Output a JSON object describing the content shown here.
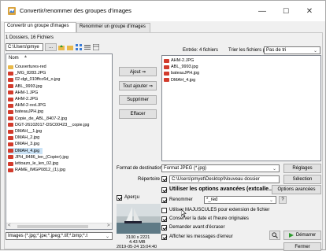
{
  "window": {
    "title": "Convertir/renommer des groupes d'images",
    "minimize": "—",
    "maximize": "☐",
    "close": "✕"
  },
  "tabs": [
    "Convertir un groupe d'images",
    "Renommer un groupe d'images"
  ],
  "left": {
    "summary": "1 Dossiers, 16 Fichiers",
    "path": "C:\\Users\\pmye",
    "path_btn": "...",
    "list_header": "Nom",
    "items": [
      {
        "name": "Couvertures-red",
        "type": "folder"
      },
      {
        "name": "_MG_8283.JPG",
        "type": "jpg"
      },
      {
        "name": "02-dgt_010ffcc6d_o.jpg",
        "type": "jpg"
      },
      {
        "name": "ABL_9993.jpg",
        "type": "jpg"
      },
      {
        "name": "AHM-1.JPG",
        "type": "jpg"
      },
      {
        "name": "AHM-2.JPG",
        "type": "jpg"
      },
      {
        "name": "AHM-2-red.JPG",
        "type": "jpg"
      },
      {
        "name": "bateauJPH.jpg",
        "type": "jpg"
      },
      {
        "name": "Copie_de_ABL_8407-2.jpg",
        "type": "jpg"
      },
      {
        "name": "DGT-26102017-DSC00423__copie.jpg",
        "type": "jpg"
      },
      {
        "name": "DMAH__1.jpg",
        "type": "jpg"
      },
      {
        "name": "DMAH_2.jpg",
        "type": "jpg"
      },
      {
        "name": "DMAH_3.jpg",
        "type": "jpg"
      },
      {
        "name": "DMAH_4.jpg",
        "type": "jpg",
        "selected": true
      },
      {
        "name": "JPH_8486_len_(Copier).jpg",
        "type": "jpg"
      },
      {
        "name": "lettoazo_le_len_02.jpg",
        "type": "jpg"
      },
      {
        "name": "RAME_IMGP0812_(1).jpg",
        "type": "jpg"
      }
    ],
    "filter": "Images (*.jpg;*.jpe;*.jpeg;*.tif;*.bmp;*.t"
  },
  "middle": {
    "add": "Ajout  ⇒",
    "add_all": "Tout ajouter  ⇒",
    "remove": "Supprimer",
    "clear": "Effacer",
    "preview_label": "Aperçu",
    "image_size": "3100 x 2221",
    "file_size": "4.43 MB",
    "file_date": "2019-05-24 15:04:40"
  },
  "right": {
    "entries": "Entrée: 4 fichiers",
    "sort_label": "Trier les fichiers par:",
    "sort_value": "Pas de tri",
    "items": [
      "AHM-2.JPG",
      "ABL_9993.jpg",
      "bateauJPH.jpg",
      "DMAH_4.jpg"
    ],
    "format_label": "Format de destination",
    "format_value": "Format JPEG (*.jpg)",
    "settings_btn": "Réglages",
    "folder_label": "Répertoire",
    "folder_value": "C:\\Users\\pmyet\\Desktop\\Nouveau dossier",
    "select_btn": "Sélection",
    "advanced_label": "Utiliser les options avancées (extcalle...",
    "advanced_btn": "Options avancées",
    "rename_label": "Renommer",
    "rename_value": "*_red",
    "help_btn": "?",
    "opt_uppercase": "Utiliser MAJUSCULES pour extension de fichier",
    "opt_keep_date": "Conserver la date et l'heure originales",
    "opt_ask_overwrite": "Demander avant d'écraser",
    "opt_show_errors": "Afficher les messages d'erreur",
    "start_btn": "Démarrer",
    "close_btn": "Fermer"
  },
  "colors": {
    "selected": "#cce4f7",
    "accent": "#0078d7",
    "start_green": "#2d9a2d"
  }
}
